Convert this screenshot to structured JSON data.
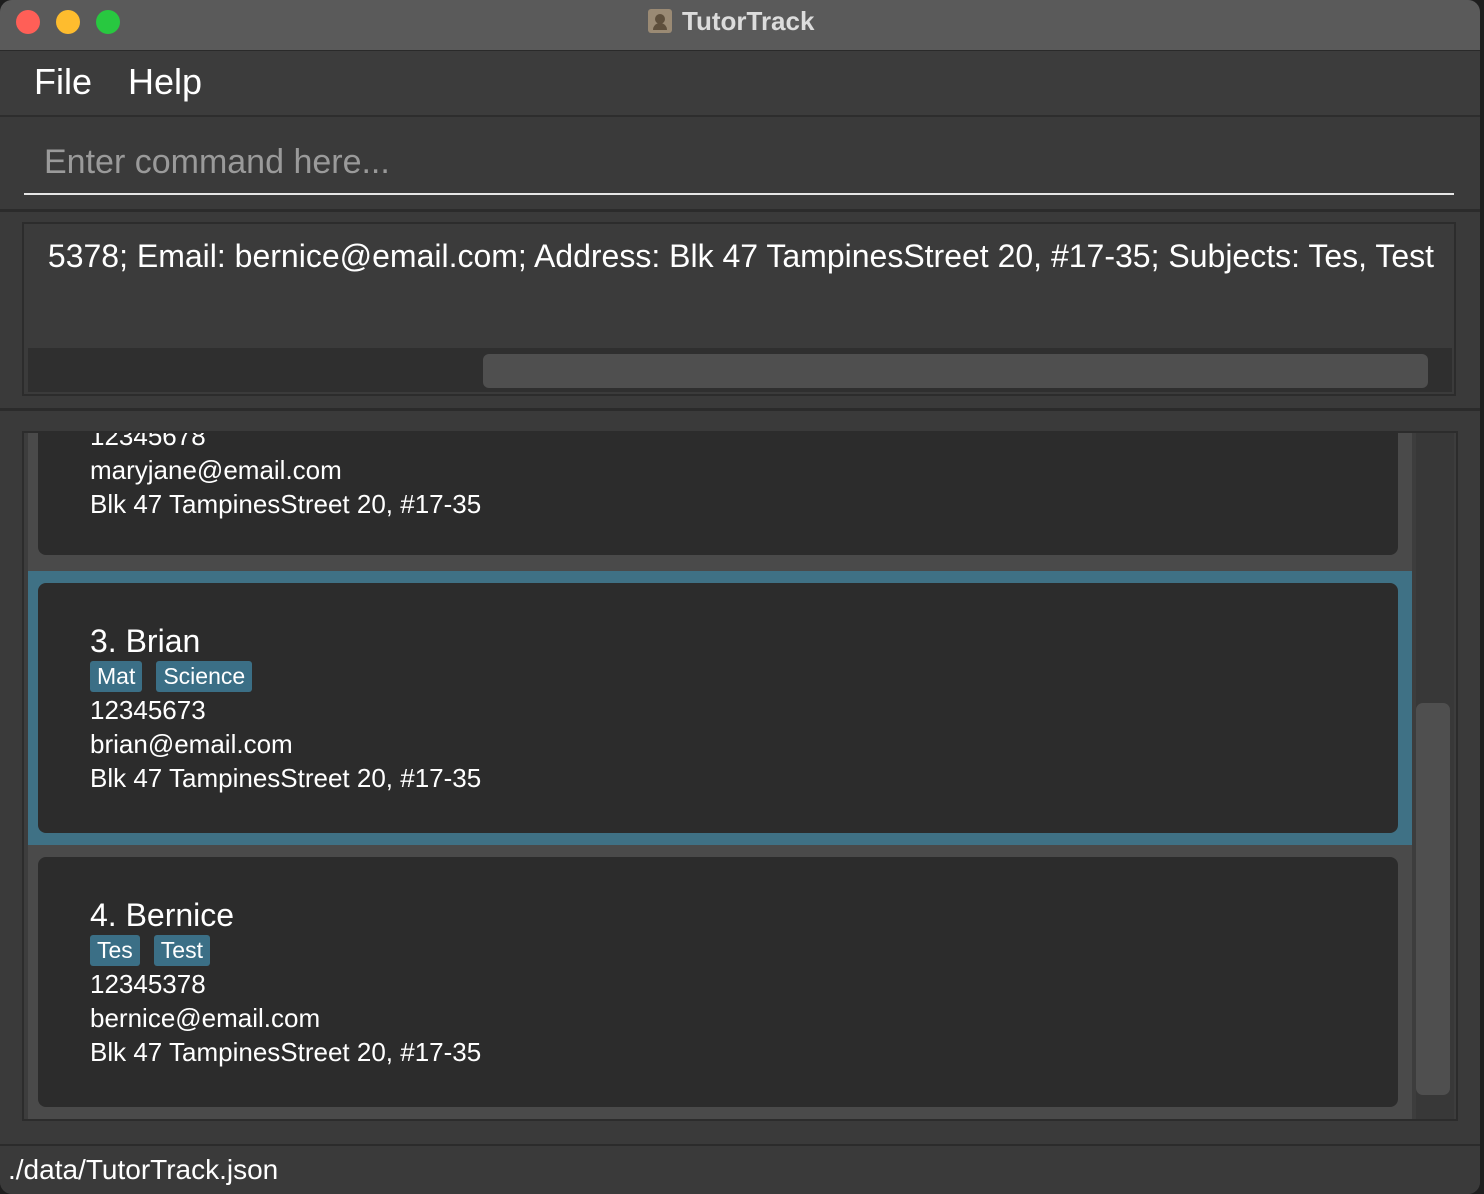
{
  "window": {
    "title": "TutorTrack"
  },
  "menu": {
    "file": "File",
    "help": "Help"
  },
  "command": {
    "placeholder": "Enter command here...",
    "value": ""
  },
  "result": {
    "text": "5378; Email: bernice@email.com; Address: Blk 47 TampinesStreet 20, #17-35; Subjects: Tes, Test"
  },
  "persons": [
    {
      "phone": "12345678",
      "email": "maryjane@email.com",
      "address": "Blk 47 TampinesStreet 20, #17-35"
    },
    {
      "name": "3. Brian",
      "tags": [
        "Mat",
        "Science"
      ],
      "phone": "12345673",
      "email": "brian@email.com",
      "address": "Blk 47 TampinesStreet 20, #17-35",
      "selected": true
    },
    {
      "name": "4. Bernice",
      "tags": [
        "Tes",
        "Test"
      ],
      "phone": "12345378",
      "email": "bernice@email.com",
      "address": "Blk 47 TampinesStreet 20, #17-35"
    }
  ],
  "status": {
    "file_path": "./data/TutorTrack.json"
  },
  "colors": {
    "selection": "#3f7185",
    "tag": "#3b6f86",
    "card": "#2c2c2c"
  }
}
